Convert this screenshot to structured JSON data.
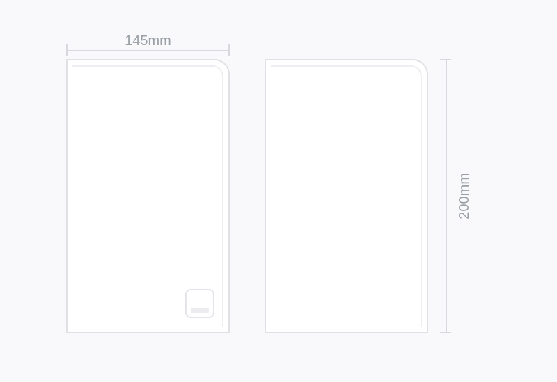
{
  "dimensions": {
    "width_label": "145mm",
    "height_label": "200mm"
  },
  "logo": {
    "name": "brand-logo"
  }
}
